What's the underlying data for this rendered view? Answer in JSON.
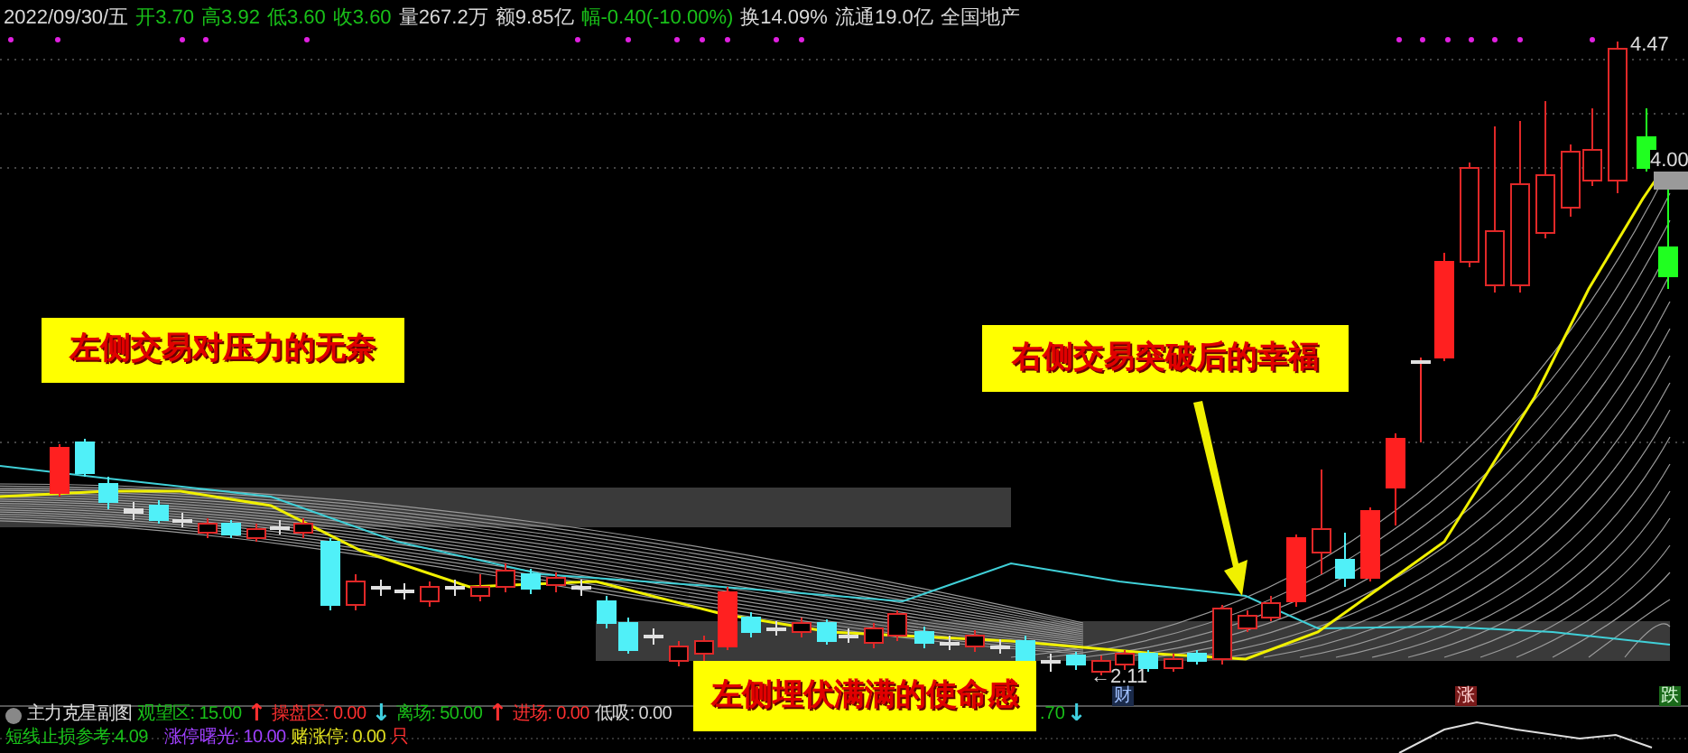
{
  "header": {
    "date": "2022/09/30/五",
    "fields": [
      {
        "text": "开3.70",
        "color": "#19c019"
      },
      {
        "text": "高3.92",
        "color": "#19c019"
      },
      {
        "text": "低3.60",
        "color": "#19c019"
      },
      {
        "text": "收3.60",
        "color": "#19c019"
      },
      {
        "text": "量267.2万",
        "color": "#d8d8d8"
      },
      {
        "text": "额9.85亿",
        "color": "#d8d8d8"
      },
      {
        "text": "幅-0.40(-10.00%)",
        "color": "#19c019"
      },
      {
        "text": "换14.09%",
        "color": "#d8d8d8"
      },
      {
        "text": "流通19.0亿",
        "color": "#d8d8d8"
      },
      {
        "text": "全国地产",
        "color": "#d8d8d8"
      }
    ]
  },
  "price_labels": [
    "4.47",
    "4.00",
    "←2.11"
  ],
  "annotations": [
    "左侧交易对压力的无奈",
    "右侧交易突破后的幸福",
    "左侧埋伏满满的使命感"
  ],
  "markers": [
    {
      "text": "财",
      "kind": "finance"
    },
    {
      "text": "涨",
      "kind": "up"
    },
    {
      "text": "跌",
      "kind": "down"
    }
  ],
  "subchart": {
    "title": "主力克星副图",
    "items": [
      {
        "label": "观望区:",
        "value": "15.00",
        "arrow": {
          "text": "↑",
          "color": "#ff3030"
        },
        "color": "#19c019"
      },
      {
        "label": "操盘区:",
        "value": "0.00",
        "arrow": {
          "text": "↓",
          "color": "#40d0e0"
        },
        "color": "#ff3030"
      },
      {
        "label": "离场:",
        "value": "50.00",
        "arrow": {
          "text": "↑",
          "color": "#ff3030"
        },
        "color": "#19c019"
      },
      {
        "label": "进场:",
        "value": "0.00",
        "color": "#ff3030"
      },
      {
        "label": "低吸:",
        "value": "0.00",
        "color": "#d8d8d8"
      },
      {
        "label": "涨停曙光:",
        "value": "10.00",
        "color": "#a040ff"
      },
      {
        "label": "赌涨停:",
        "value": "0.00",
        "color": "#e0e020"
      },
      {
        "label": "只",
        "color": "#ff3030"
      }
    ],
    "tail": {
      "value": ".70",
      "arrow": {
        "text": "↓",
        "color": "#40d0e0"
      },
      "color": "#19c019"
    },
    "stop_loss": "短线止损参考:4.09"
  }
}
